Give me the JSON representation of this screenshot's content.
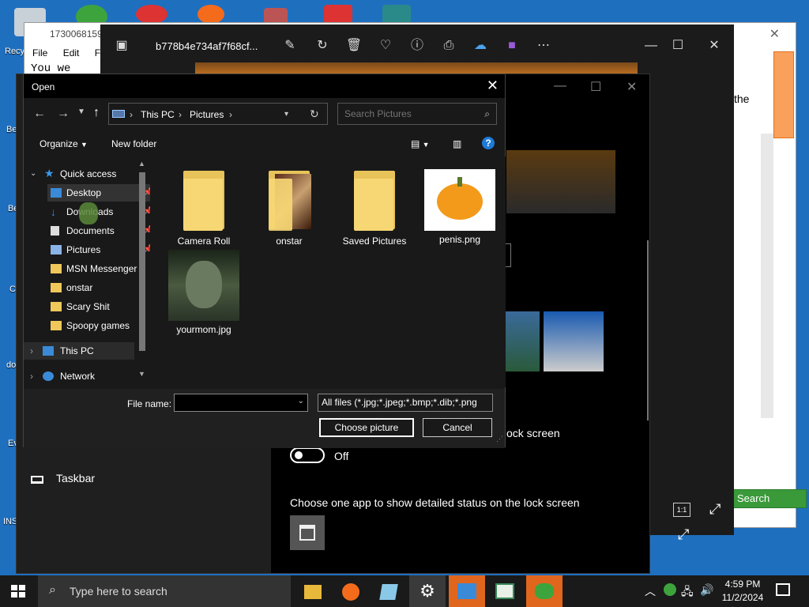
{
  "desktop": {
    "edge_labels": [
      "Recy",
      "Be",
      "Be",
      "C",
      "do",
      "Ev",
      "INS"
    ]
  },
  "notepad": {
    "title": "1730068159",
    "menu": [
      "File",
      "Edit",
      "F"
    ],
    "text": "You we",
    "right_text": "the",
    "search_label": "Search"
  },
  "photos": {
    "filename": "b778b4e734af7f68cf...",
    "toolbar_icons": [
      "edit-icon",
      "rotate-icon",
      "delete-icon",
      "favorite-icon",
      "info-icon",
      "print-icon",
      "onedrive-icon",
      "clipchamp-icon",
      "more-icon"
    ]
  },
  "settings": {
    "sidebar_item": "Taskbar",
    "lock_screen_text": "ock screen",
    "toggle_state": "Off",
    "detailed_status_text": "Choose one app to show detailed status on the lock screen"
  },
  "dialog": {
    "title": "Open",
    "address": [
      "This PC",
      "Pictures"
    ],
    "search_placeholder": "Search Pictures",
    "organize": "Organize",
    "new_folder": "New folder",
    "nav": {
      "quick_access": "Quick access",
      "items": [
        {
          "label": "Desktop",
          "pinned": true
        },
        {
          "label": "Downloads",
          "pinned": true
        },
        {
          "label": "Documents",
          "pinned": true
        },
        {
          "label": "Pictures",
          "pinned": true
        },
        {
          "label": "MSN Messenger",
          "pinned": false
        },
        {
          "label": "onstar",
          "pinned": false
        },
        {
          "label": "Scary Shit",
          "pinned": false
        },
        {
          "label": "Spoopy games",
          "pinned": false
        }
      ],
      "this_pc": "This PC",
      "network": "Network"
    },
    "files": [
      {
        "name": "Camera Roll",
        "kind": "folder"
      },
      {
        "name": "onstar",
        "kind": "folder-with-image"
      },
      {
        "name": "Saved Pictures",
        "kind": "folder"
      },
      {
        "name": "penis.png",
        "kind": "image-pumpkin"
      },
      {
        "name": "yourmom.jpg",
        "kind": "image-face"
      }
    ],
    "file_name_label": "File name:",
    "file_name_value": "",
    "file_type": "All files (*.jpg;*.jpeg;*.bmp;*.dib;*.png",
    "choose_button": "Choose picture",
    "cancel_button": "Cancel"
  },
  "taskbar": {
    "search_placeholder": "Type here to search",
    "time": "4:59 PM",
    "date": "11/2/2024"
  }
}
